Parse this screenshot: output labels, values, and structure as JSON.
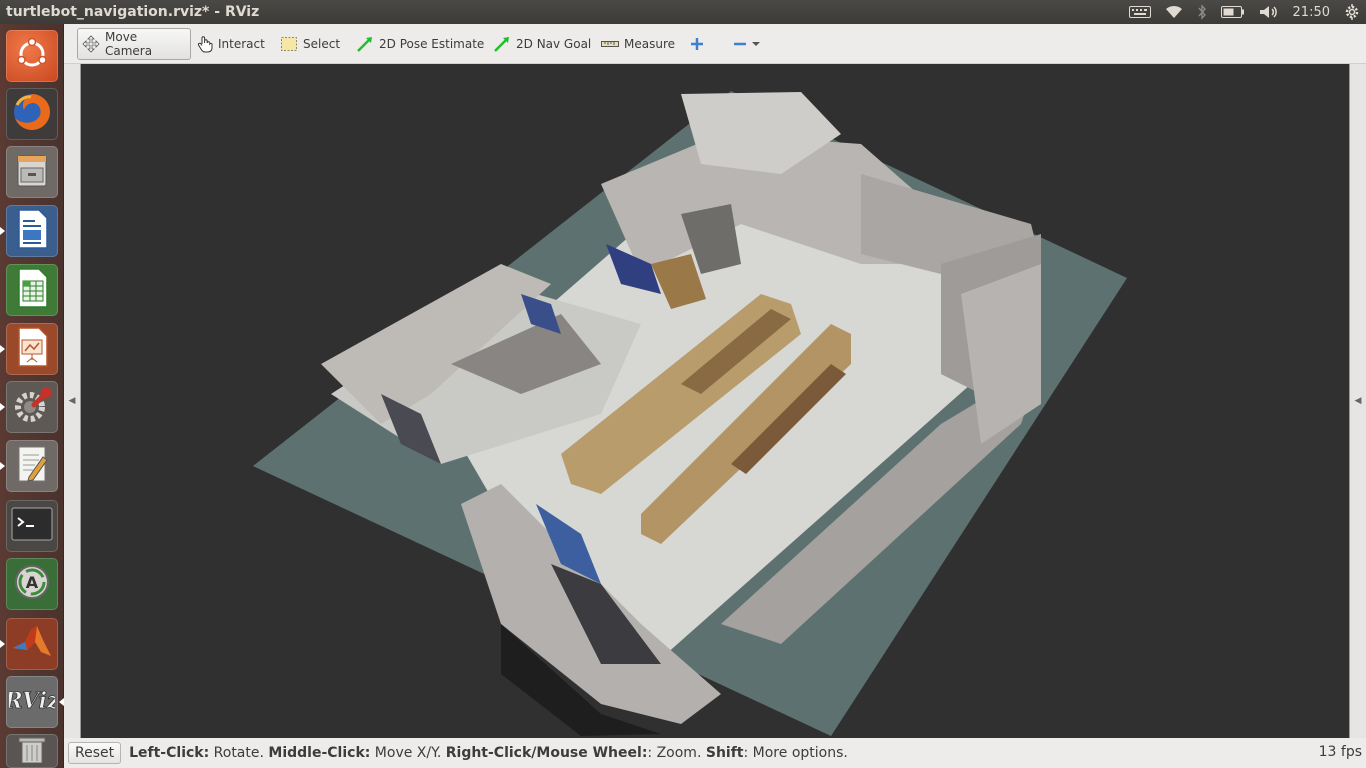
{
  "window": {
    "title": "turtlebot_navigation.rviz* - RViz"
  },
  "panel": {
    "clock": "21:50",
    "indicators": [
      "keyboard-icon",
      "wifi-icon",
      "bluetooth-icon",
      "battery-icon",
      "volume-icon",
      "settings-gear-icon"
    ]
  },
  "launcher": {
    "items": [
      {
        "name": "ubuntu-dash",
        "icon": "ubuntu-logo-icon",
        "color": "#e05a2b"
      },
      {
        "name": "firefox",
        "icon": "firefox-icon",
        "color": "#3f7ad5"
      },
      {
        "name": "files",
        "icon": "file-cabinet-icon",
        "color": "#8a8a8a"
      },
      {
        "name": "writer",
        "icon": "document-icon",
        "color": "#2f6fb3"
      },
      {
        "name": "calc",
        "icon": "spreadsheet-icon",
        "color": "#3e9a36"
      },
      {
        "name": "impress",
        "icon": "presentation-icon",
        "color": "#c7582a"
      },
      {
        "name": "system-settings",
        "icon": "wrench-gear-icon",
        "color": "#8a8a8a"
      },
      {
        "name": "text-editor",
        "icon": "pencil-document-icon",
        "color": "#9b9b9b"
      },
      {
        "name": "terminal",
        "icon": "terminal-icon",
        "color": "#3a3a3a"
      },
      {
        "name": "software-updater",
        "icon": "updater-icon",
        "color": "#3e8a3a"
      },
      {
        "name": "matlab",
        "icon": "matlab-icon",
        "color": "#c04a2a"
      },
      {
        "name": "rviz",
        "icon": "rviz-icon",
        "color": "#777777"
      },
      {
        "name": "trash",
        "icon": "trash-icon",
        "color": "#6a6a6a"
      }
    ]
  },
  "toolbar": {
    "move_camera": "Move Camera",
    "interact": "Interact",
    "select": "Select",
    "pose_estimate": "2D Pose Estimate",
    "nav_goal": "2D Nav Goal",
    "measure": "Measure"
  },
  "status": {
    "reset": "Reset",
    "left_click_key": "Left-Click:",
    "left_click_val": " Rotate. ",
    "middle_click_key": "Middle-Click:",
    "middle_click_val": " Move X/Y. ",
    "right_click_key": "Right-Click/Mouse Wheel:",
    "right_click_val": ": Zoom. ",
    "shift_key": "Shift",
    "shift_val": ": More options.",
    "fps": "13 fps"
  },
  "colors": {
    "viewport_bg": "#303030",
    "grid_plane": "#5e7472",
    "floor": "#d9d9d6",
    "walls": "#bdbab6",
    "shelves": "#b89a6a"
  }
}
